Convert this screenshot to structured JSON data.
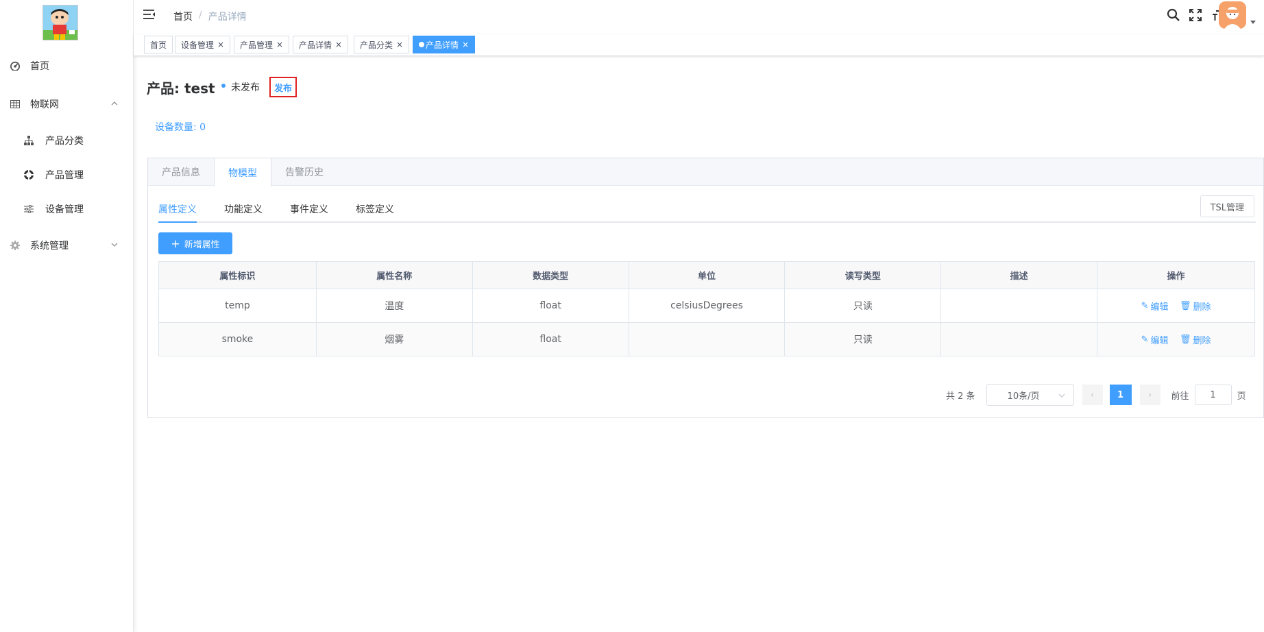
{
  "sidebar": {
    "items": [
      {
        "label": "首页",
        "icon": "dashboard-icon"
      },
      {
        "label": "物联网",
        "icon": "grid-icon"
      },
      {
        "label": "产品分类",
        "icon": "tree-icon"
      },
      {
        "label": "产品管理",
        "icon": "target-icon"
      },
      {
        "label": "设备管理",
        "icon": "sliders-icon"
      },
      {
        "label": "系统管理",
        "icon": "gear-icon"
      }
    ]
  },
  "header": {
    "breadcrumb": [
      "首页",
      "/",
      "产品详情"
    ]
  },
  "tags": [
    "首页",
    "设备管理",
    "产品管理",
    "产品详情",
    "产品分类",
    "产品详情"
  ],
  "product": {
    "title": "产品: test",
    "status": "未发布",
    "publish": "发布",
    "device_count": "设备数量: 0"
  },
  "card_tabs": [
    "产品信息",
    "物模型",
    "告警历史"
  ],
  "sub_tabs": [
    "属性定义",
    "功能定义",
    "事件定义",
    "标签定义"
  ],
  "tsl_button": "TSL管理",
  "add_button": "新增属性",
  "table": {
    "headers": [
      "属性标识",
      "属性名称",
      "数据类型",
      "单位",
      "读写类型",
      "描述",
      "操作"
    ],
    "rows": [
      {
        "id": "temp",
        "name": "温度",
        "type": "float",
        "unit": "celsiusDegrees",
        "rw": "只读",
        "desc": ""
      },
      {
        "id": "smoke",
        "name": "烟雾",
        "type": "float",
        "unit": "",
        "rw": "只读",
        "desc": ""
      }
    ],
    "edit": "编辑",
    "delete": "删除"
  },
  "pager": {
    "total": "共 2 条",
    "size": "10条/页",
    "page": "1",
    "goto": "前往",
    "goto_value": "1",
    "page_suffix": "页"
  },
  "colors": {
    "accent": "#409eff",
    "highlight": "#e02020"
  }
}
